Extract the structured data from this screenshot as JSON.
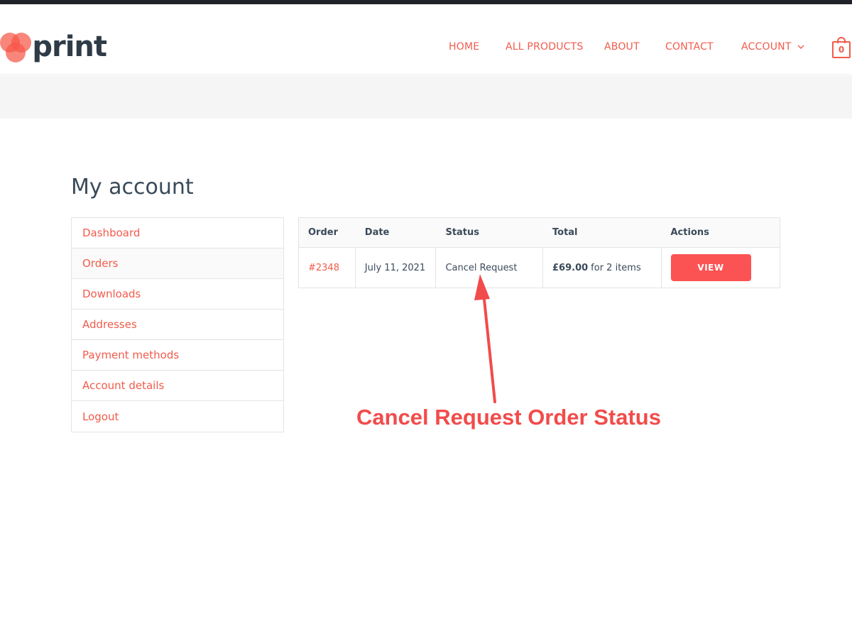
{
  "brand": {
    "logo_text": "print",
    "accent_color": "#f25b4c"
  },
  "nav": {
    "home": "HOME",
    "all_products": "ALL PRODUCTS",
    "about": "ABOUT",
    "contact": "CONTACT",
    "account": "ACCOUNT",
    "cart_count": "0"
  },
  "page": {
    "title": "My account"
  },
  "sidebar": {
    "items": [
      {
        "label": "Dashboard"
      },
      {
        "label": "Orders"
      },
      {
        "label": "Downloads"
      },
      {
        "label": "Addresses"
      },
      {
        "label": "Payment methods"
      },
      {
        "label": "Account details"
      },
      {
        "label": "Logout"
      }
    ]
  },
  "orders": {
    "headers": {
      "order": "Order",
      "date": "Date",
      "status": "Status",
      "total": "Total",
      "actions": "Actions"
    },
    "rows": [
      {
        "order": "#2348",
        "date": "July 11, 2021",
        "status": "Cancel Request",
        "total_amount": "£69.00",
        "total_items": "for 2 items",
        "action": "VIEW"
      }
    ]
  },
  "annotation": {
    "text": "Cancel Request Order Status",
    "color": "#f24b4b"
  }
}
